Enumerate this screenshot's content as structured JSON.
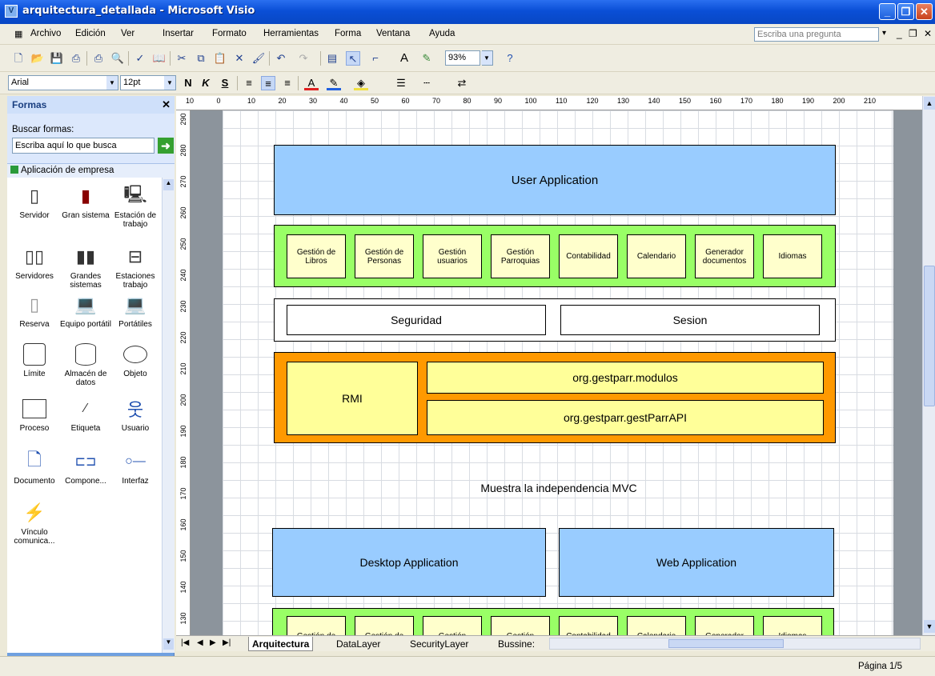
{
  "window": {
    "title": "arquitectura_detallada - Microsoft Visio",
    "icon": "visio-app-icon"
  },
  "menu": {
    "items": [
      "Archivo",
      "Edición",
      "Ver",
      "Insertar",
      "Formato",
      "Herramientas",
      "Forma",
      "Ventana",
      "Ayuda"
    ],
    "ask_placeholder": "Escriba una pregunta"
  },
  "toolbar": {
    "zoom": "93%",
    "font": "Arial",
    "font_size": "12pt",
    "bold": "N",
    "italic": "K",
    "underline": "S"
  },
  "shapes_pane": {
    "title": "Formas",
    "search_label": "Buscar formas:",
    "search_placeholder": "Escriba aquí lo que busca",
    "stencil": "Aplicación de empresa",
    "shapes": [
      {
        "label": "Servidor",
        "icon": "server-icon"
      },
      {
        "label": "Gran sistema",
        "icon": "mainframe-icon"
      },
      {
        "label": "Estación de trabajo",
        "icon": "workstation-icon"
      },
      {
        "label": "Servidores",
        "icon": "servers-icon"
      },
      {
        "label": "Grandes sistemas",
        "icon": "mainframes-icon"
      },
      {
        "label": "Estaciones trabajo",
        "icon": "workstations-icon"
      },
      {
        "label": "Reserva",
        "icon": "backup-icon"
      },
      {
        "label": "Equipo portátil",
        "icon": "laptop-icon"
      },
      {
        "label": "Portátiles",
        "icon": "laptops-icon"
      },
      {
        "label": "Límite",
        "icon": "boundary-icon"
      },
      {
        "label": "Almacén de datos",
        "icon": "datastore-icon"
      },
      {
        "label": "Objeto",
        "icon": "object-icon"
      },
      {
        "label": "Proceso",
        "icon": "process-icon"
      },
      {
        "label": "Etiqueta",
        "icon": "label-icon"
      },
      {
        "label": "Usuario",
        "icon": "user-icon"
      },
      {
        "label": "Documento",
        "icon": "document-icon"
      },
      {
        "label": "Compone...",
        "icon": "component-icon"
      },
      {
        "label": "Interfaz",
        "icon": "interface-icon"
      },
      {
        "label": "Vínculo comunica...",
        "icon": "link-icon"
      }
    ]
  },
  "ruler": {
    "top": [
      "10",
      "0",
      "10",
      "20",
      "30",
      "40",
      "50",
      "60",
      "70",
      "80",
      "90",
      "100",
      "110",
      "120",
      "130",
      "140",
      "150",
      "160",
      "170",
      "180",
      "190",
      "200",
      "210"
    ],
    "left": [
      "290",
      "280",
      "270",
      "260",
      "250",
      "240",
      "230",
      "220",
      "210",
      "200",
      "190",
      "180",
      "170",
      "160",
      "150",
      "140",
      "130"
    ]
  },
  "diagram": {
    "user_app": "User Application",
    "modules": [
      "Gestión de Libros",
      "Gestión de Personas",
      "Gestión usuarios",
      "Gestión Parroquias",
      "Contabilidad",
      "Calendario",
      "Generador documentos",
      "Idiomas"
    ],
    "security": "Seguridad",
    "session": "Sesion",
    "rmi": "RMI",
    "modulos": "org.gestparr.modulos",
    "api": "org.gestparr.gestParrAPI",
    "note": "Muestra la independencia MVC",
    "desktop": "Desktop Application",
    "web": "Web Application",
    "modules2": [
      "Gestión de",
      "Gestión de",
      "Gestión",
      "Gestión",
      "Contabilidad",
      "Calendario",
      "Generador",
      "Idiomas"
    ]
  },
  "colors": {
    "blue_box": "#99CCFF",
    "green": "#99FF66",
    "yellow": "#FFFF99",
    "orange": "#FF9900",
    "module_bg": "#FFFFCC"
  },
  "tabs": [
    "Arquitectura",
    "DataLayer",
    "SecurityLayer",
    "Bussine:"
  ],
  "status": {
    "page": "Página 1/5"
  }
}
